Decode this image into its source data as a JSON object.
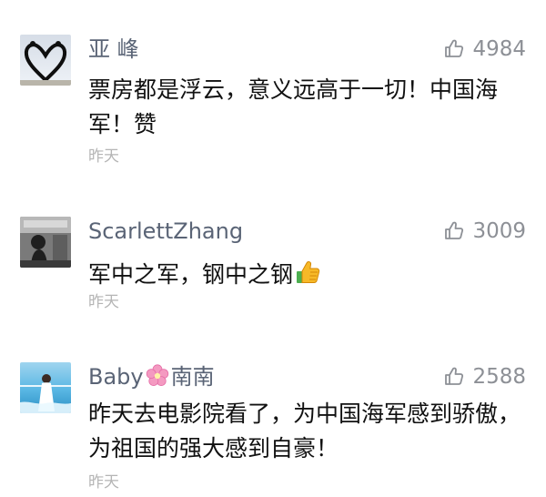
{
  "comments": [
    {
      "name": "亚 峰",
      "likes": "4984",
      "text": "票房都是浮云，意义远高于一切！中国海军！赞",
      "time": "昨天"
    },
    {
      "name": "ScarlettZhang",
      "likes": "3009",
      "text": "军中之军，钢中之钢",
      "time": "昨天"
    },
    {
      "name_prefix": "Baby",
      "name_suffix": "南南",
      "likes": "2588",
      "text": "昨天去电影院看了，为中国海军感到骄傲，为祖国的强大感到自豪！",
      "time": "昨天"
    }
  ],
  "icons": {
    "like": "thumbs-up-outline-icon",
    "thumbs_emoji": "thumbs-up-emoji-icon",
    "flower": "cherry-blossom-icon"
  },
  "colors": {
    "name": "#5a6476",
    "likes": "#8d9096",
    "text": "#111111",
    "time": "#b5b5b5"
  }
}
